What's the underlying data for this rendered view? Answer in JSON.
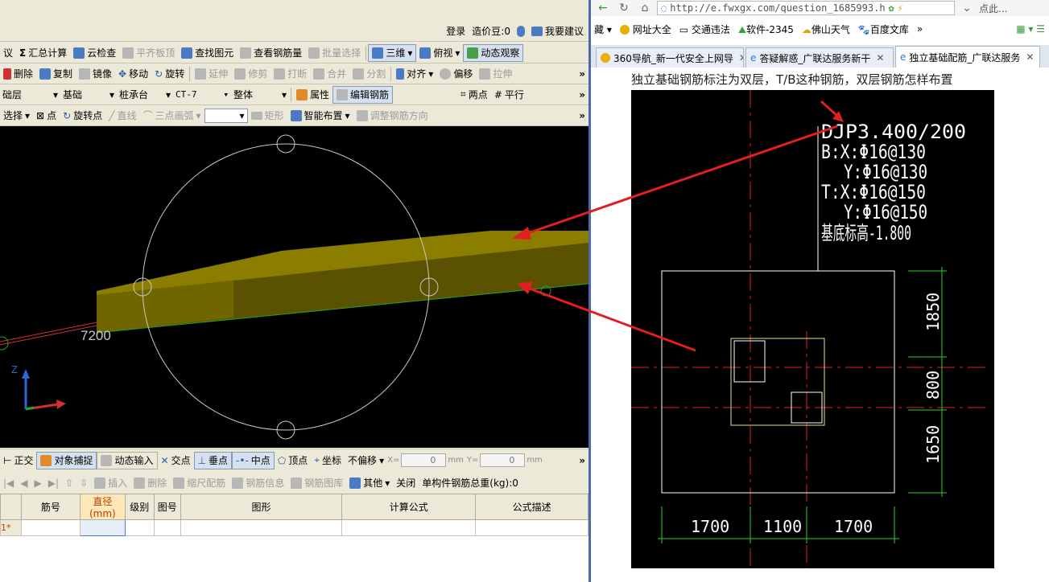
{
  "left_app": {
    "topbar": {
      "login": "登录",
      "price_beans": "造价豆:0",
      "suggest": "我要建议"
    },
    "toolbar1": {
      "items": [
        "议",
        "汇总计算",
        "云检查",
        "平齐板顶",
        "查找图元",
        "查看钢筋量",
        "批量选择"
      ],
      "view_3d": "三维",
      "view_top": "俯视",
      "dynamic_observe": "动态观察"
    },
    "toolbar2": {
      "items": [
        "删除",
        "复制",
        "镜像",
        "移动",
        "旋转",
        "延伸",
        "修剪",
        "打断",
        "合并",
        "分割",
        "对齐",
        "偏移",
        "拉伸"
      ]
    },
    "toolbar3": {
      "layer": "础层",
      "category": "基础",
      "type": "桩承台",
      "element": "CT-7",
      "scope": "整体",
      "properties": "属性",
      "edit_rebar": "编辑钢筋",
      "two_points": "两点",
      "parallel": "平行"
    },
    "toolbar4": {
      "select": "选择",
      "point": "点",
      "rotate_point": "旋转点",
      "line": "直线",
      "three_point_arc": "三点画弧",
      "rect": "矩形",
      "smart_layout": "智能布置",
      "adjust_rebar_dir": "调整钢筋方向"
    },
    "canvas": {
      "dimension_label": "7200",
      "axis_z": "Z"
    },
    "snapbar": {
      "items": [
        "正交",
        "对象捕捉",
        "动态输入",
        "交点",
        "垂点",
        "中点",
        "顶点",
        "坐标"
      ],
      "offset_mode": "不偏移",
      "x_label": "X=",
      "x_value": "0",
      "x_unit": "mm",
      "y_label": "Y=",
      "y_value": "0",
      "y_unit": "mm"
    },
    "rebarbar": {
      "items": [
        "插入",
        "删除",
        "缩尺配筋",
        "钢筋信息",
        "钢筋图库",
        "其他",
        "关闭"
      ],
      "total_weight": "单构件钢筋总重(kg):0"
    },
    "grid": {
      "columns": [
        "筋号",
        "直径(mm)",
        "级别",
        "图号",
        "图形",
        "计算公式",
        "公式描述"
      ],
      "rows": [
        {
          "id": "1*",
          "values": [
            "",
            "",
            "",
            "",
            "",
            "",
            ""
          ]
        }
      ]
    }
  },
  "browser": {
    "url": "http://e.fwxgx.com/question_1685993.h",
    "right_text": "点此...",
    "bookmarks": [
      "藏",
      "网址大全",
      "交通违法",
      "软件-2345",
      "佛山天气",
      "百度文库"
    ],
    "tabs": [
      {
        "label": "360导航_新一代安全上网导",
        "active": false
      },
      {
        "label": "答疑解惑_广联达服务新干",
        "active": false
      },
      {
        "label": "独立基础配筋_广联达服务",
        "active": true
      }
    ],
    "question_title": "独立基础钢筋标注为双层，T/B这种钢筋，双层钢筋怎样布置",
    "cad_annotation": {
      "label": "DJP3.400/200",
      "bottom_x": "B:X:Φ16@130",
      "bottom_y": "Y:Φ16@130",
      "top_x": "T:X:Φ16@150",
      "top_y": "Y:Φ16@150",
      "elevation": "基底标高-1.800"
    },
    "cad_dimensions": {
      "vertical": [
        "1850",
        "800",
        "1650"
      ],
      "horizontal": [
        "1700",
        "1100",
        "1700"
      ]
    }
  }
}
